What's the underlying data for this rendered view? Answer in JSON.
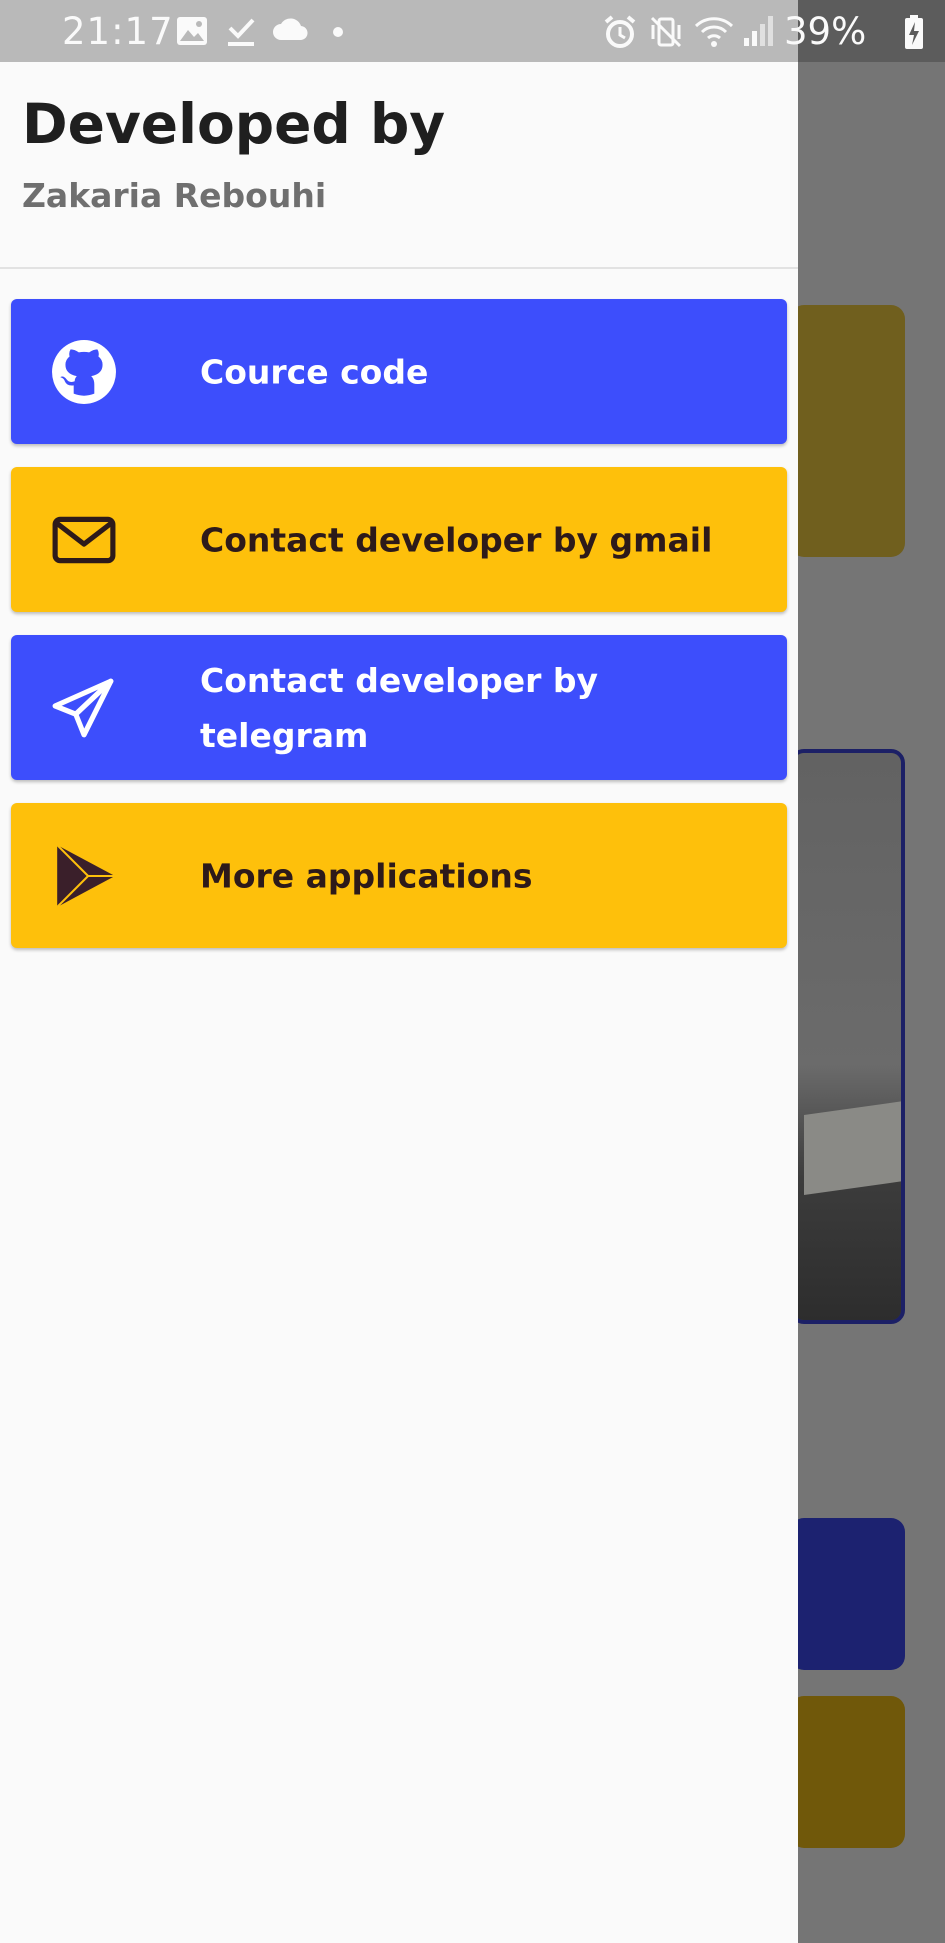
{
  "status_bar": {
    "time": "21:17",
    "battery": "39%",
    "left_icons": [
      "image-icon",
      "download-done-icon",
      "cloud-icon",
      "dot-icon"
    ],
    "right_icons": [
      "alarm-icon",
      "vibrate-icon",
      "wifi-icon",
      "signal-icon",
      "battery-charging-icon"
    ]
  },
  "drawer": {
    "title": "Developed by",
    "subtitle": "Zakaria Rebouhi",
    "items": [
      {
        "label": "Cource code",
        "icon": "github-icon",
        "color": "#3d4efc"
      },
      {
        "label": "Contact developer by gmail",
        "icon": "mail-icon",
        "color": "#fec00b"
      },
      {
        "label": "Contact developer by telegram",
        "icon": "telegram-icon",
        "color": "#3d4efc"
      },
      {
        "label": "More applications",
        "icon": "play-store-icon",
        "color": "#fec00b"
      }
    ]
  },
  "colors": {
    "primary_blue": "#3d4efc",
    "accent_yellow": "#fec00b",
    "scrim": "#757575"
  }
}
